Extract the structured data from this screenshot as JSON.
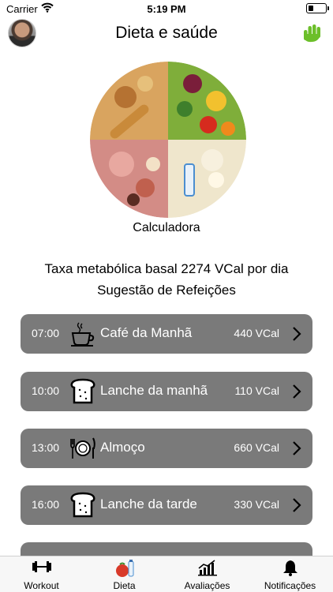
{
  "status_bar": {
    "carrier": "Carrier",
    "time": "5:19 PM",
    "battery_level": 0.3
  },
  "header": {
    "title": "Dieta e saúde",
    "avatar_icon": "user-avatar",
    "right_icon": "hand-icon",
    "right_icon_color": "#6cbf2a"
  },
  "main": {
    "image_icon": "food-plate-photo",
    "calculator_label": "Calculadora",
    "bmr_text": "Taxa metabólica basal 2274 VCal por dia",
    "suggestion_text": "Sugestão de Refeições"
  },
  "meals": [
    {
      "time": "07:00",
      "icon": "coffee-cup-icon",
      "name": "Café da Manhã",
      "kcal": "440 VCal"
    },
    {
      "time": "10:00",
      "icon": "bread-icon",
      "name": "Lanche da manhã",
      "kcal": "110 VCal"
    },
    {
      "time": "13:00",
      "icon": "plate-cutlery-icon",
      "name": "Almoço",
      "kcal": "660 VCal"
    },
    {
      "time": "16:00",
      "icon": "bread-icon",
      "name": "Lanche da tarde",
      "kcal": "330 VCal"
    }
  ],
  "meal_row_color": "#7a7a7a",
  "tab_bar": {
    "tabs": [
      {
        "label": "Workout",
        "icon": "dumbbell-icon"
      },
      {
        "label": "Dieta",
        "icon": "diet-food-icon"
      },
      {
        "label": "Avaliações",
        "icon": "chart-icon"
      },
      {
        "label": "Notificações",
        "icon": "bell-icon"
      }
    ]
  }
}
